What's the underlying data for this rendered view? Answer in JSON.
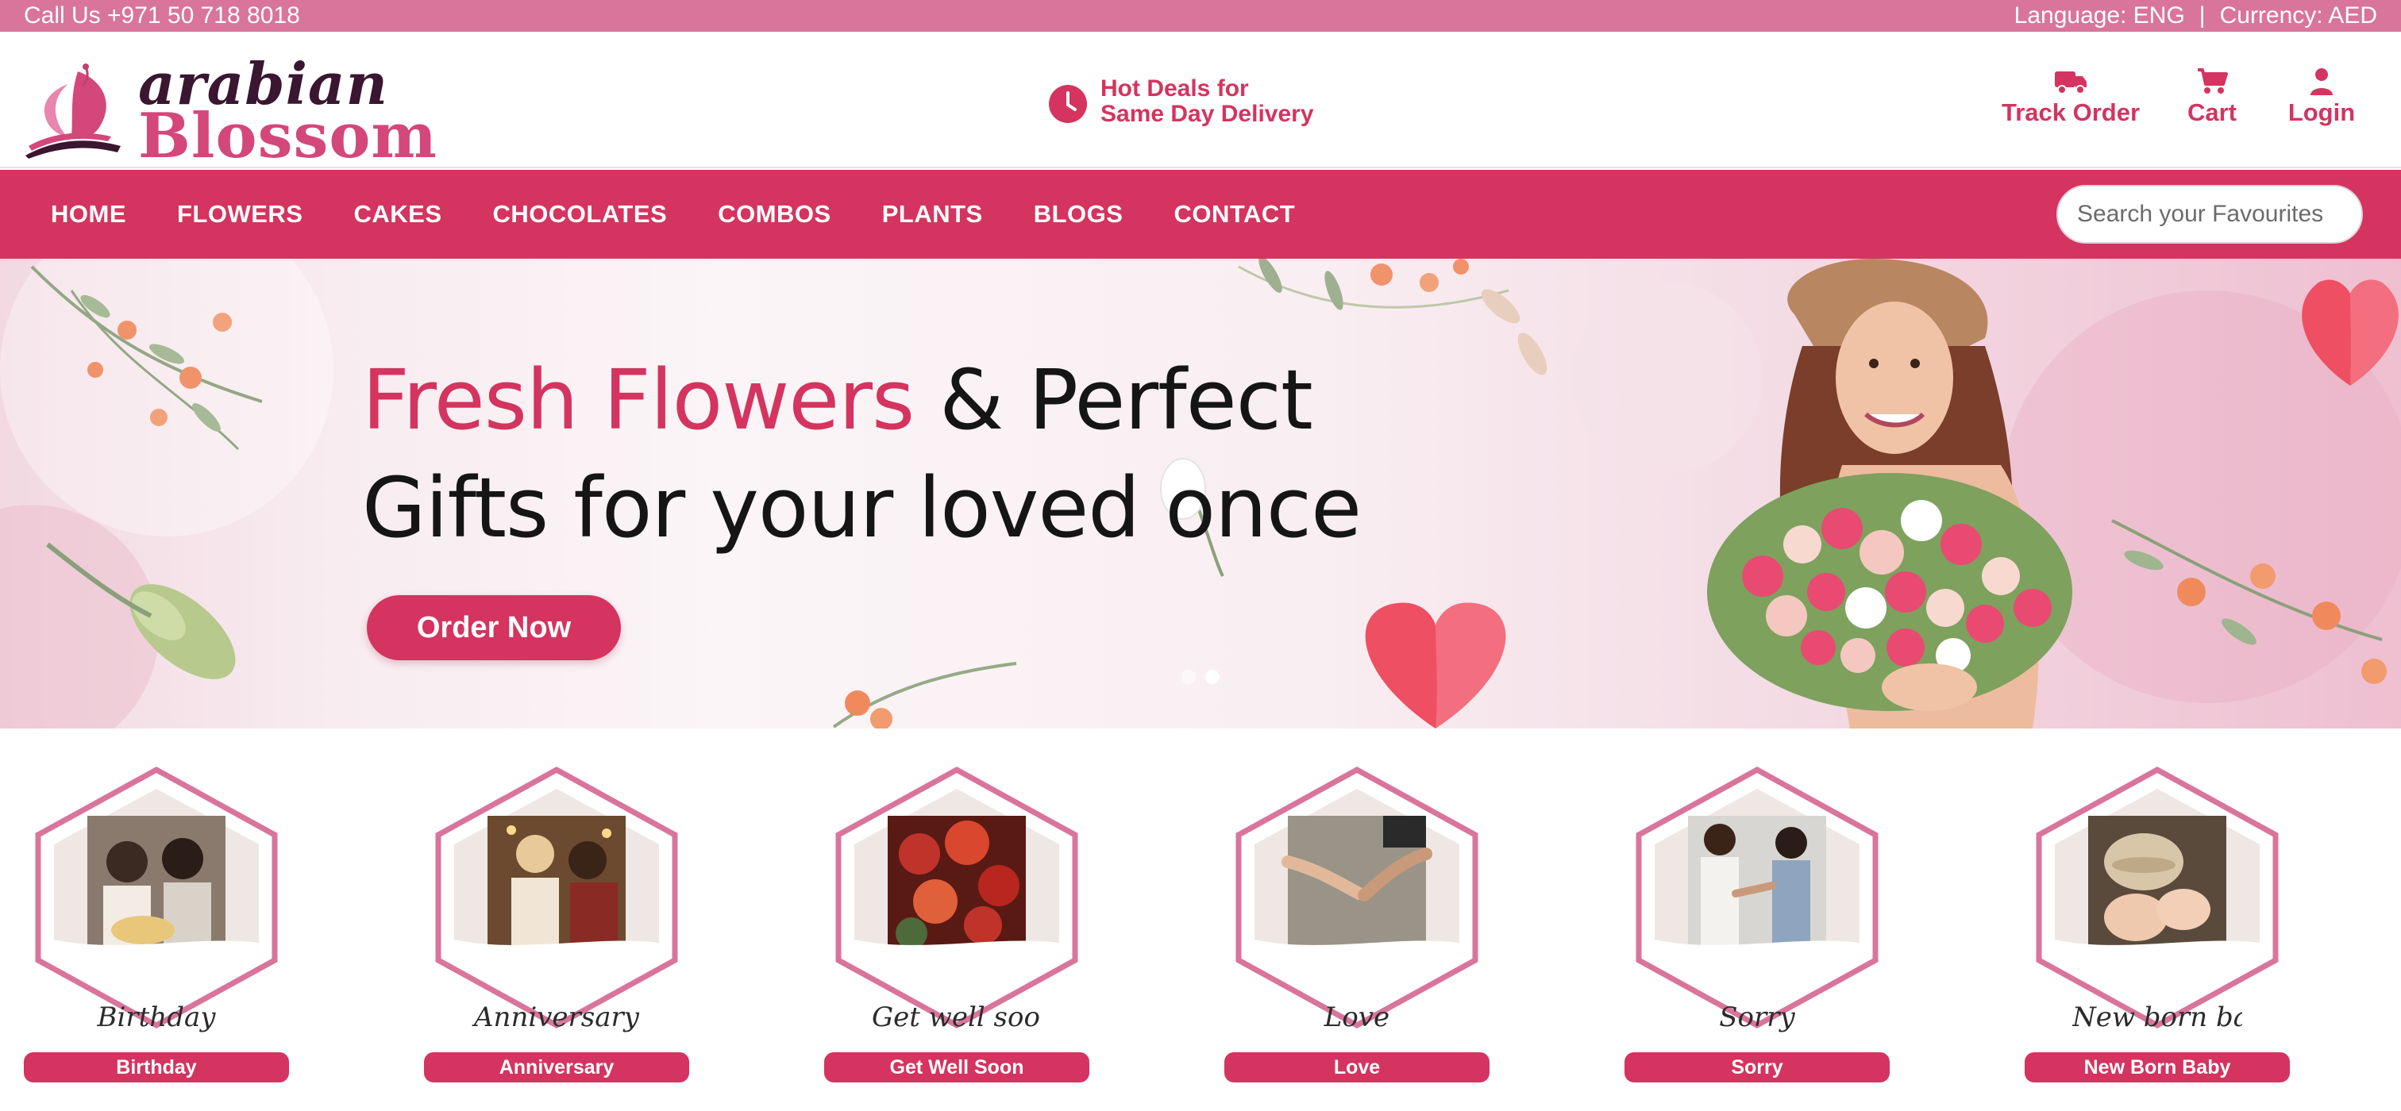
{
  "topbar": {
    "call": "Call Us +971 50 718 8018",
    "language": "Language: ENG",
    "separator": "|",
    "currency": "Currency: AED"
  },
  "brand": {
    "line1": "arabian",
    "line2": "Blossom",
    "accent_color": "#d4345f",
    "dark_color": "#3a1630"
  },
  "deals": {
    "line1": "Hot Deals for",
    "line2": "Same Day Delivery",
    "icon": "clock-icon"
  },
  "header_links": [
    {
      "label": "Track Order",
      "icon": "truck-icon"
    },
    {
      "label": "Cart",
      "icon": "cart-icon"
    },
    {
      "label": "Login",
      "icon": "user-icon"
    }
  ],
  "nav": {
    "items": [
      "HOME",
      "FLOWERS",
      "CAKES",
      "CHOCOLATES",
      "COMBOS",
      "PLANTS",
      "BLOGS",
      "CONTACT"
    ],
    "search_placeholder": "Search your Favourites"
  },
  "hero": {
    "title_pink": "Fresh Flowers",
    "title_rest": " & Perfect",
    "title_line2": "Gifts for your loved once",
    "button": "Order Now",
    "slide_count": 2,
    "active_slide": 2
  },
  "occasions": [
    {
      "label": "Birthday",
      "script": "Birthday"
    },
    {
      "label": "Anniversary",
      "script": "Anniversary"
    },
    {
      "label": "Get Well Soon",
      "script": "Get well soon"
    },
    {
      "label": "Love",
      "script": "Love"
    },
    {
      "label": "Sorry",
      "script": "Sorry"
    },
    {
      "label": "New Born Baby",
      "script": "New born baby"
    }
  ],
  "colors": {
    "topbar": "#d9749b",
    "nav": "#d4345f",
    "hex_border": "#d9749b",
    "hex_fill": "#efe7e3"
  }
}
